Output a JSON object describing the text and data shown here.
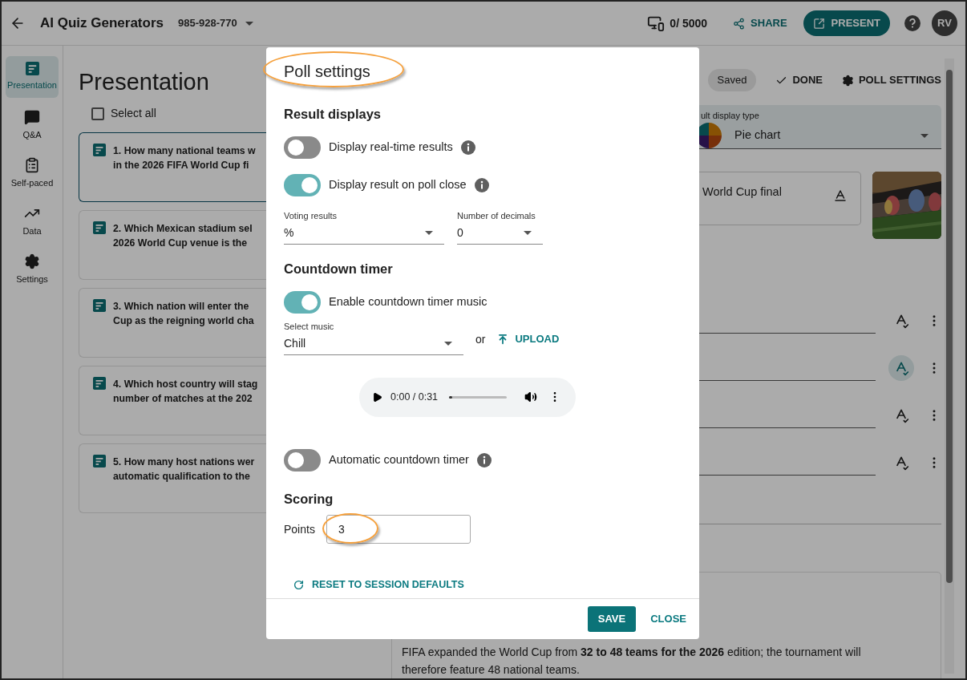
{
  "top_bar": {
    "title": "AI Quiz Generators",
    "code": "985-928-770",
    "participants": "0/ 5000",
    "share": "SHARE",
    "present": "PRESENT",
    "avatar": "RV"
  },
  "sidebar": {
    "items": [
      {
        "label": "Presentation",
        "selected": true
      },
      {
        "label": "Q&A",
        "selected": false
      },
      {
        "label": "Self-paced",
        "selected": false
      },
      {
        "label": "Data",
        "selected": false
      },
      {
        "label": "Settings",
        "selected": false
      }
    ]
  },
  "content": {
    "heading": "Presentation",
    "select_all": {
      "label": "Select all",
      "checked": false
    },
    "questions": [
      {
        "lines": [
          "1. How many national teams w",
          "in the 2026 FIFA World Cup fi"
        ],
        "selected": true
      },
      {
        "lines": [
          "2. Which Mexican stadium sel",
          "2026 World Cup venue is the"
        ],
        "selected": false
      },
      {
        "lines": [
          "3. Which nation will enter the",
          "Cup as the reigning world cha"
        ],
        "selected": false
      },
      {
        "lines": [
          "4. Which host country will stag",
          "number of matches at the 202"
        ],
        "selected": false
      },
      {
        "lines": [
          "5. How many host nations wer",
          "automatic qualification to the"
        ],
        "selected": false
      }
    ]
  },
  "editor": {
    "saved": "Saved",
    "done": "DONE",
    "poll_settings": "POLL SETTINGS",
    "display_type": {
      "label": "ult display type",
      "value": "Pie chart"
    },
    "question_text": "World Cup final",
    "answers": [
      {
        "selected": false
      },
      {
        "selected": true
      },
      {
        "selected": false
      },
      {
        "selected": false
      }
    ],
    "explanation": "FIFA expanded the World Cup from **32 to 48 teams for the 2026** edition; the tournament will therefore feature 48 national teams."
  },
  "dialog": {
    "title": "Poll settings",
    "title_highlighted": true,
    "result_heading": "Result displays",
    "result_toggles": [
      {
        "label": "Display real-time results",
        "on": false
      },
      {
        "label": "Display result on poll close",
        "on": true
      }
    ],
    "voting_results": {
      "label": "Voting results",
      "value": "%"
    },
    "decimals": {
      "label": "Number of decimals",
      "value": "0"
    },
    "countdown_heading": "Countdown timer",
    "music_toggle": {
      "label": "Enable countdown timer music",
      "on": true
    },
    "select_music": {
      "label": "Select music",
      "value": "Chill"
    },
    "or": "or",
    "upload": "UPLOAD",
    "audio": {
      "time": "0:00 / 0:31",
      "level": 0.05
    },
    "auto_toggle": {
      "label": "Automatic countdown timer",
      "on": false
    },
    "scoring_heading": "Scoring",
    "points": {
      "label": "Points",
      "value": "3",
      "highlighted": true
    },
    "reset": "RESET TO SESSION DEFAULTS",
    "save": "SAVE",
    "close": "CLOSE"
  }
}
